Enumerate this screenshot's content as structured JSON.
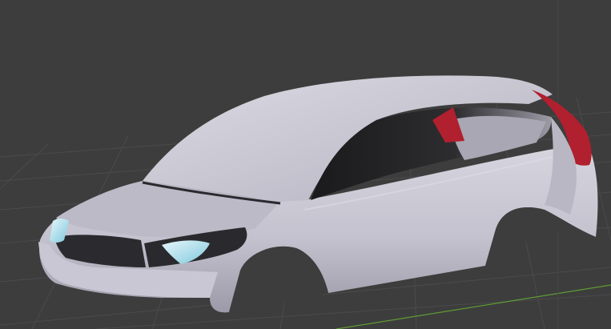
{
  "viewport": {
    "background": "#3d3d3d",
    "grid_color": "#4a4a4a",
    "y_axis_color": "#6aa53a",
    "model": "car-body-shell",
    "body_color": "#c8c6d2",
    "taillight_color": "#b0202e",
    "headlight_color": "#a8e0ee"
  }
}
